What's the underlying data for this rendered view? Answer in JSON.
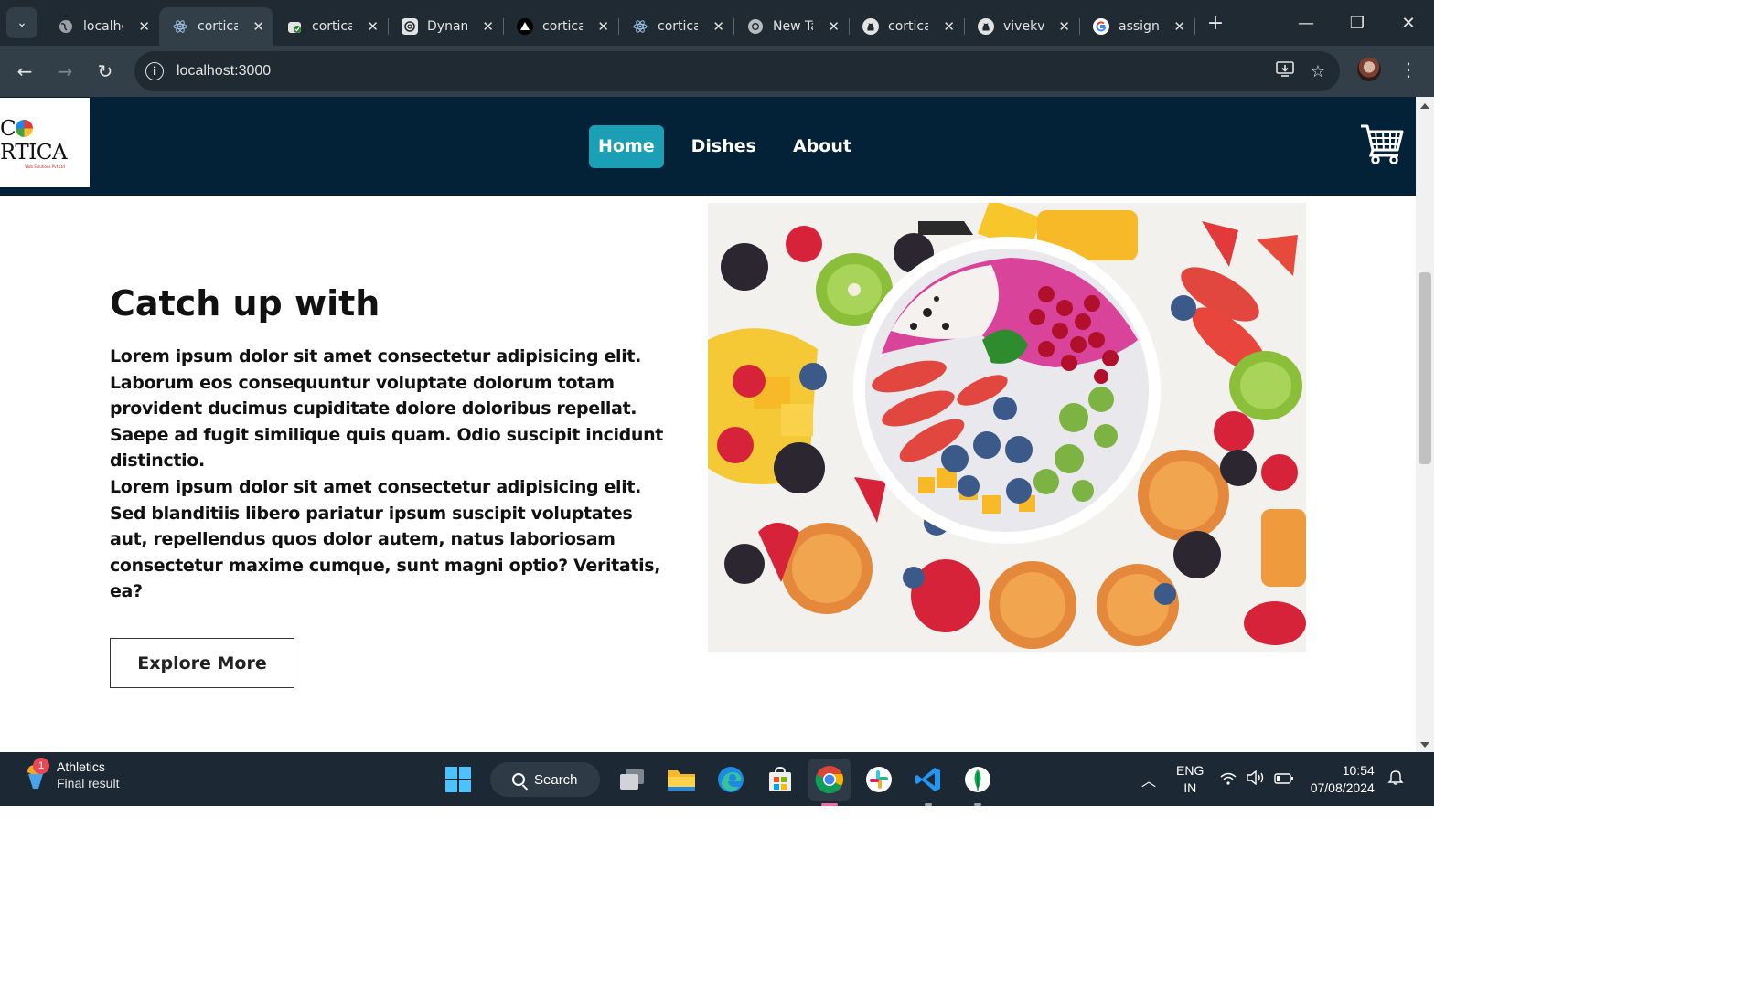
{
  "browser": {
    "tabs": [
      {
        "label": "localhost",
        "icon": "globe-icon",
        "active": false
      },
      {
        "label": "cortica",
        "icon": "react-icon",
        "active": true
      },
      {
        "label": "cortica",
        "icon": "cloud-check-icon",
        "active": false
      },
      {
        "label": "Dynamic",
        "icon": "openai-icon",
        "active": false
      },
      {
        "label": "cortica",
        "icon": "vercel-icon",
        "active": false
      },
      {
        "label": "cortica",
        "icon": "react-icon",
        "active": false
      },
      {
        "label": "New Tab",
        "icon": "chrome-icon",
        "active": false
      },
      {
        "label": "cortica",
        "icon": "github-icon",
        "active": false
      },
      {
        "label": "vivekv",
        "icon": "github-icon",
        "active": false
      },
      {
        "label": "assignment",
        "icon": "google-icon",
        "active": false
      }
    ],
    "url": "localhost:3000"
  },
  "site": {
    "logo_text_pre": "C",
    "logo_text_post": "RTICA",
    "logo_subtext": "Web Solutions Pvt Ltd",
    "nav": {
      "home": "Home",
      "dishes": "Dishes",
      "about": "About"
    },
    "hero": {
      "title": "Catch up with",
      "paragraph1": "Lorem ipsum dolor sit amet consectetur adipisicing elit. Laborum eos consequuntur voluptate dolorum totam provident ducimus cupiditate dolore doloribus repellat. Saepe ad fugit similique quis quam. Odio suscipit incidunt distinctio.",
      "paragraph2": "Lorem ipsum dolor sit amet consectetur adipisicing elit. Sed blanditiis libero pariatur ipsum suscipit voluptates aut, repellendus quos dolor autem, natus laboriosam consectetur maxime cumque, sunt magni optio? Veritatis, ea?",
      "button": "Explore More"
    }
  },
  "taskbar": {
    "weather_title": "Athletics",
    "weather_subtitle": "Final result",
    "notification_count": "1",
    "search_label": "Search",
    "lang_line1": "ENG",
    "lang_line2": "IN",
    "time": "10:54",
    "date": "07/08/2024"
  }
}
